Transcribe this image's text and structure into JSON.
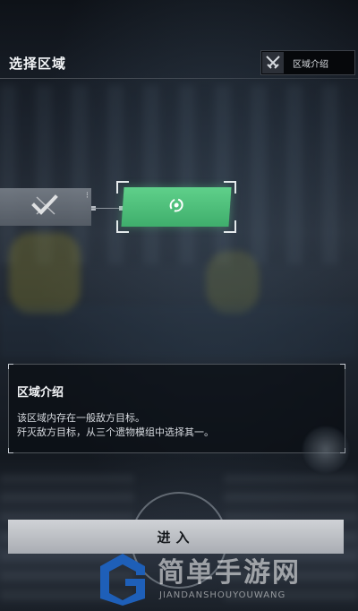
{
  "header": {
    "title": "选择区域",
    "intro_button_label": "区域介绍",
    "intro_button_icon": "crossed-swords-icon"
  },
  "map": {
    "nodes": [
      {
        "state": "completed",
        "icon": "check-swords-icon"
      },
      {
        "state": "selected",
        "icon": "target-reticle-icon",
        "color": "#4fc27a"
      }
    ]
  },
  "info_panel": {
    "title": "区域介绍",
    "lines": [
      "该区域内存在一般敌方目标。",
      "歼灭敌方目标，从三个遗物模组中选择其一。"
    ]
  },
  "enter_button": {
    "label": "进入"
  },
  "watermark": {
    "title": "简单手游网",
    "subtitle": "JIANDANSHOUYOUWANG"
  }
}
